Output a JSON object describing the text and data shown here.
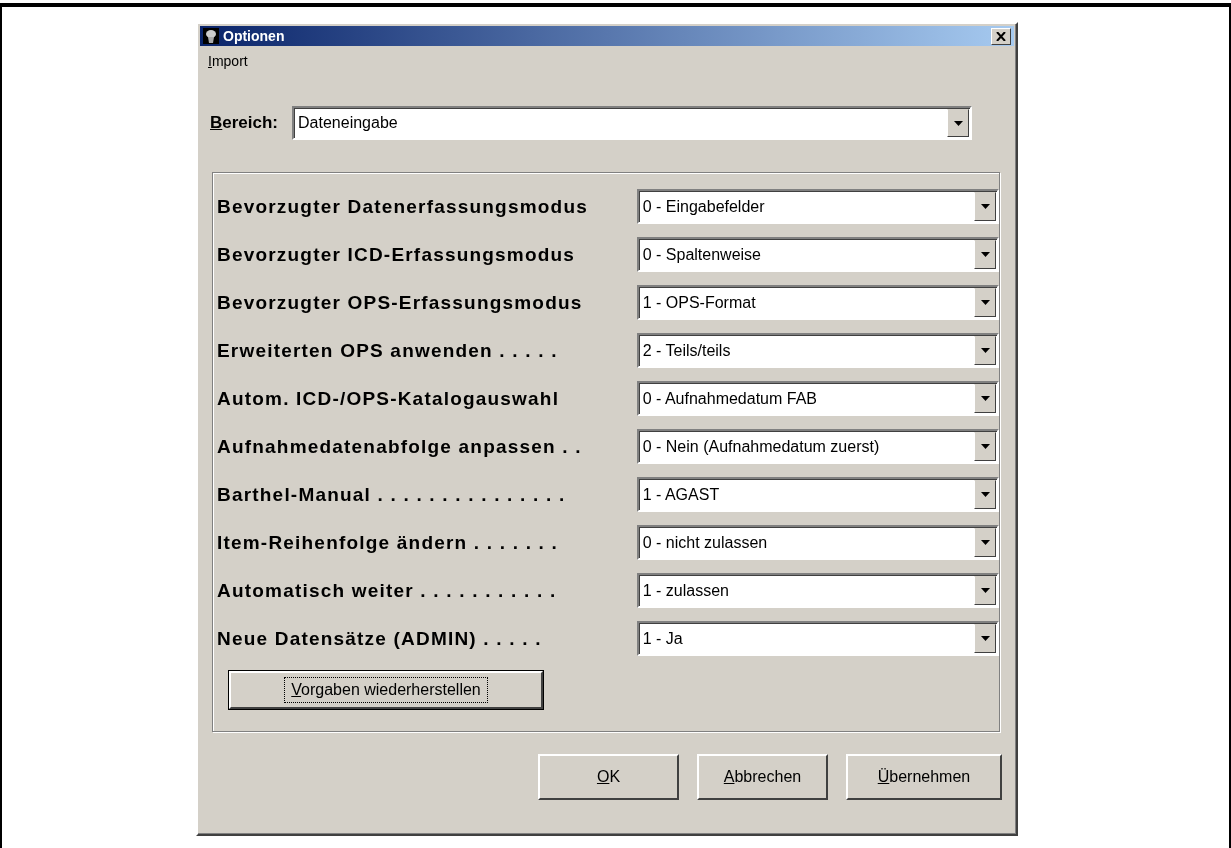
{
  "window": {
    "title": "Optionen"
  },
  "menu": [
    {
      "label": "Import"
    }
  ],
  "bereich": {
    "label": "Bereich:",
    "value": "Dateneingabe"
  },
  "options": [
    {
      "label": "Bevorzugter Datenerfassungsmodus",
      "value": "0 - Eingabefelder"
    },
    {
      "label": "Bevorzugter ICD-Erfassungsmodus",
      "value": "0 - Spaltenweise"
    },
    {
      "label": "Bevorzugter OPS-Erfassungsmodus",
      "value": "1 - OPS-Format"
    },
    {
      "label": "Erweiterten OPS anwenden . . . . .",
      "value": "2 - Teils/teils"
    },
    {
      "label": "Autom. ICD-/OPS-Katalogauswahl",
      "value": "0 - Aufnahmedatum FAB"
    },
    {
      "label": "Aufnahmedatenabfolge anpassen . .",
      "value": "0 - Nein (Aufnahmedatum zuerst)"
    },
    {
      "label": "Barthel-Manual . . . . . . . . . . . . . . .",
      "value": "1 - AGAST"
    },
    {
      "label": "Item-Reihenfolge ändern . . . . . . .",
      "value": "0 - nicht zulassen"
    },
    {
      "label": "Automatisch weiter . . . . . . . . . . .",
      "value": "1 - zulassen"
    },
    {
      "label": "Neue Datensätze (ADMIN) . . . . .",
      "value": "1 - Ja"
    }
  ],
  "restore_button": {
    "label": "Vorgaben wiederherstellen",
    "focused": true
  },
  "buttons": [
    {
      "label": "OK"
    },
    {
      "label": "Abbrechen"
    },
    {
      "label": "Übernehmen"
    }
  ]
}
